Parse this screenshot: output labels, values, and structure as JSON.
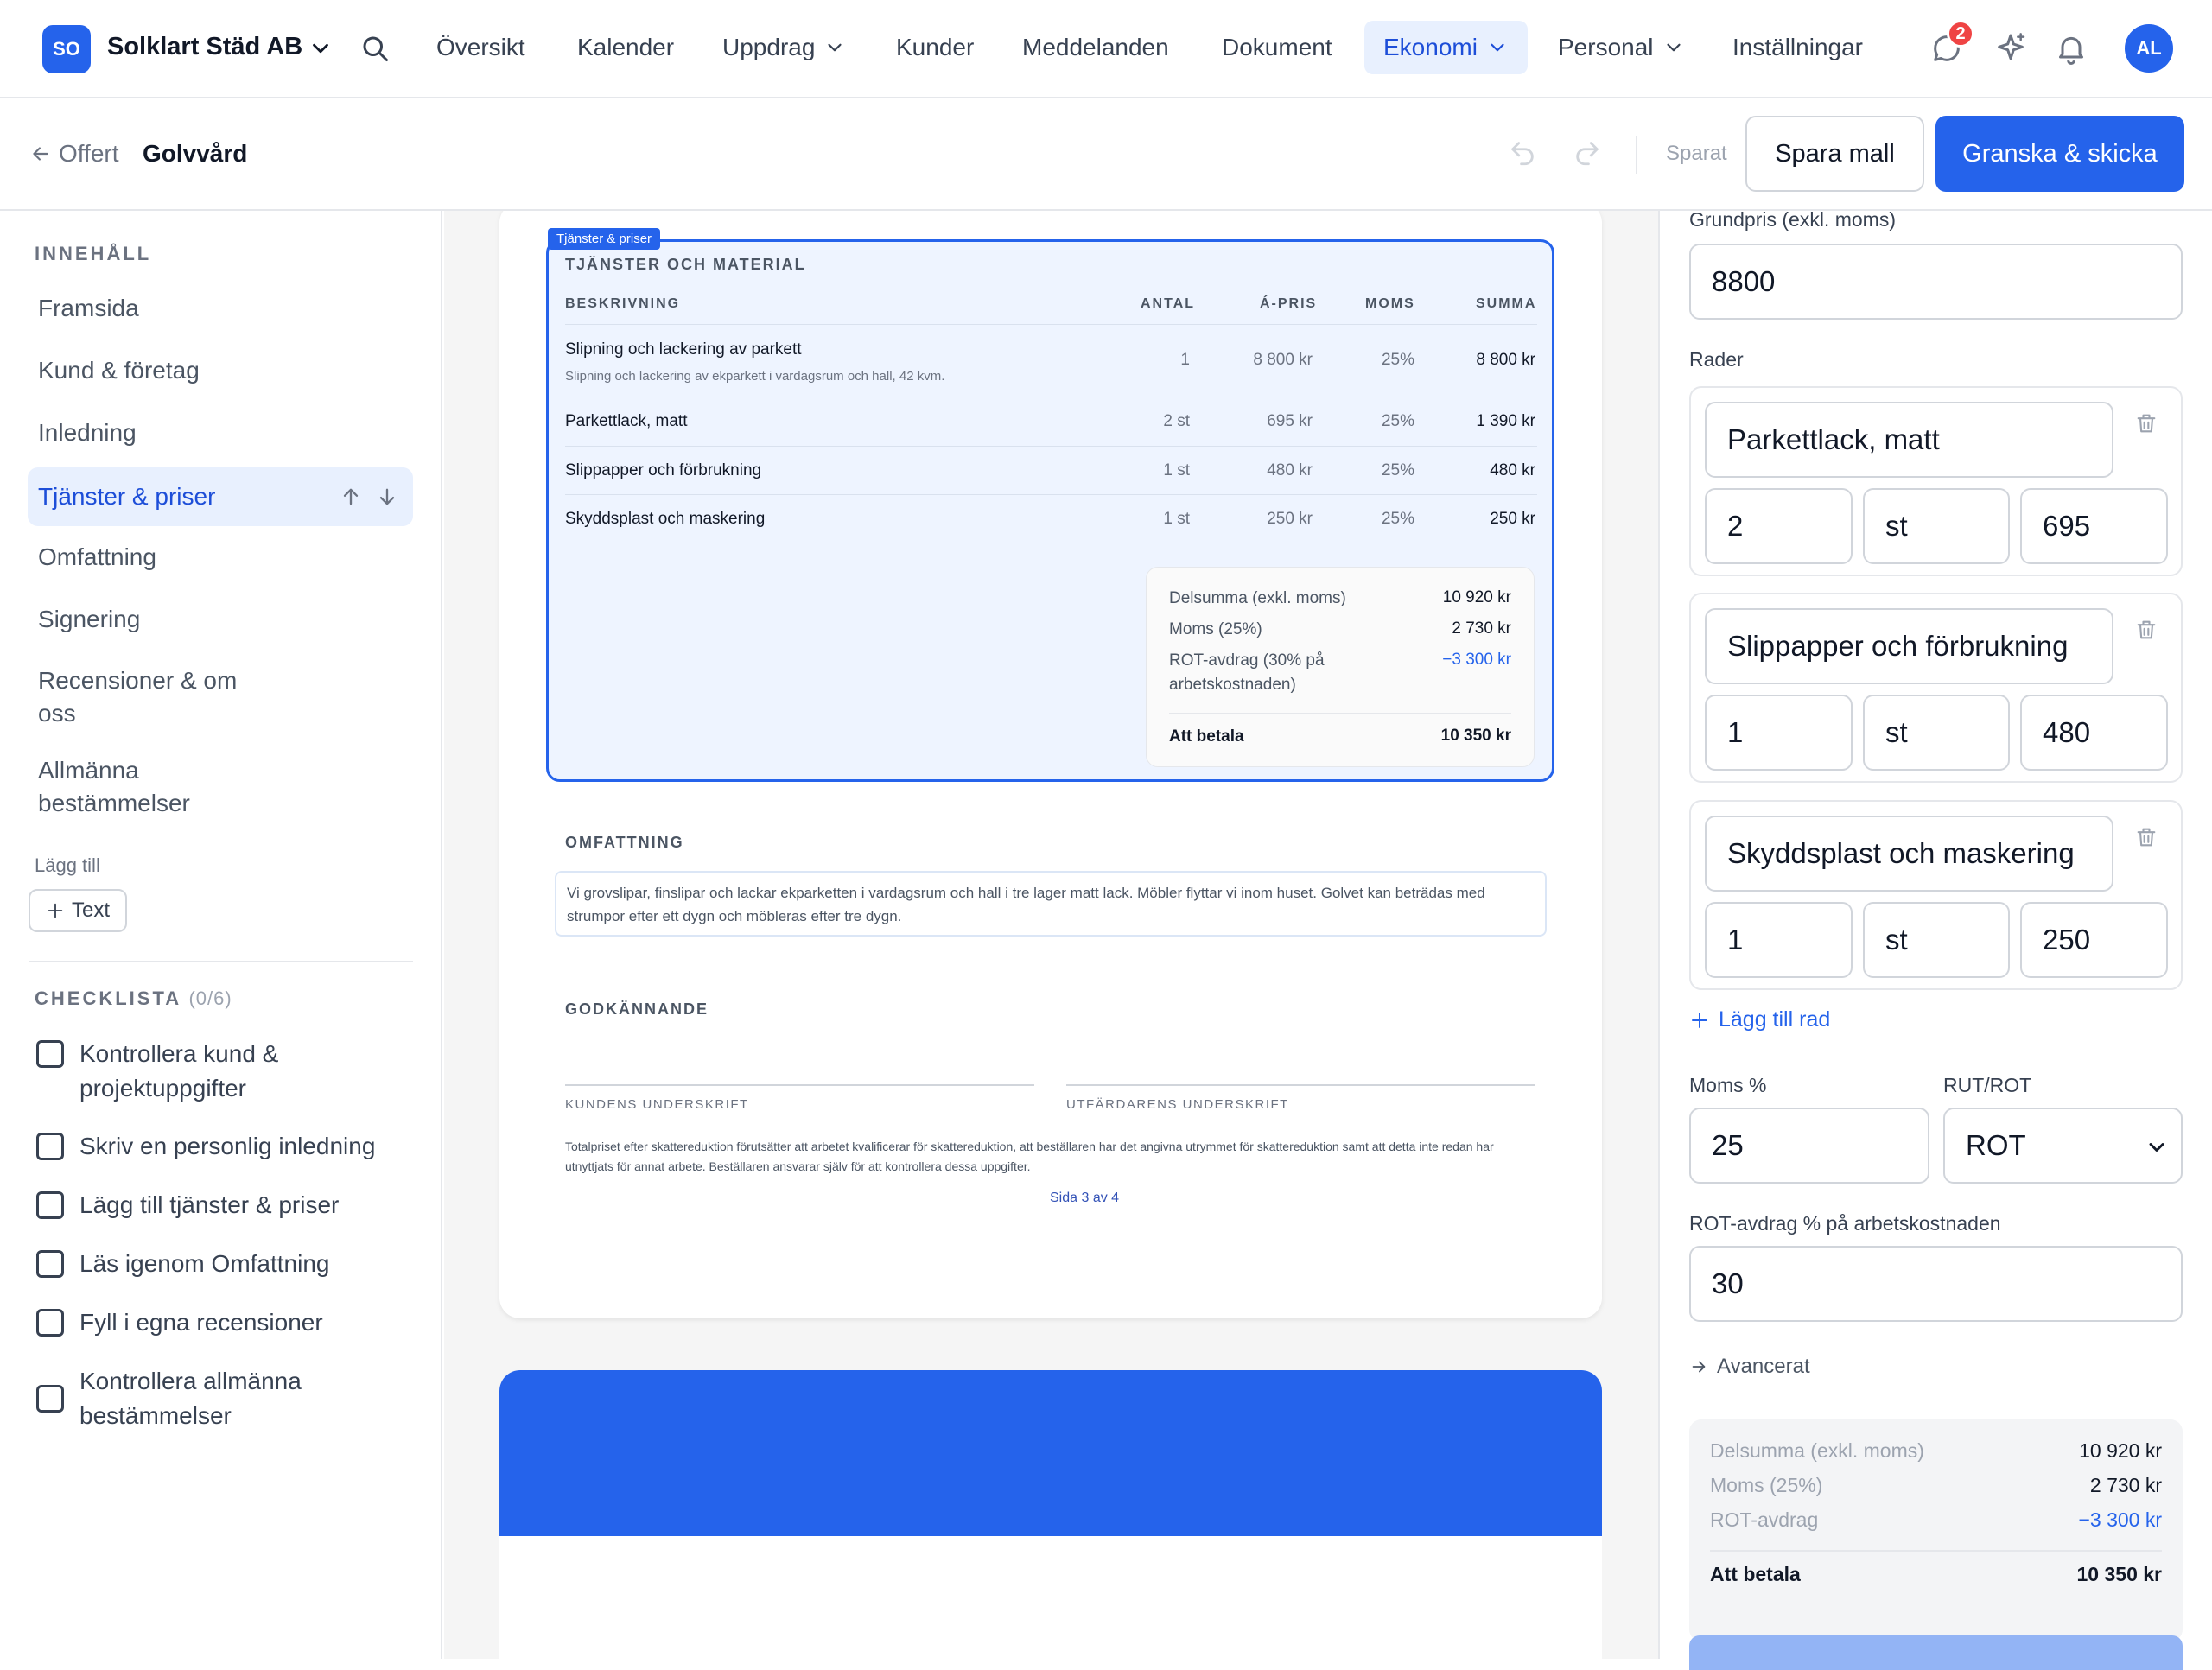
{
  "topnav": {
    "logo_text": "SO",
    "company": "Solklart Städ AB",
    "items": [
      "Översikt",
      "Kalender",
      "Uppdrag",
      "Kunder",
      "Meddelanden",
      "Dokument",
      "Ekonomi",
      "Personal",
      "Inställningar"
    ],
    "active_item": "Ekonomi",
    "notification_count": "2",
    "avatar_initials": "AL"
  },
  "subbar": {
    "breadcrumb_parent": "Offert",
    "breadcrumb_current": "Golvvård",
    "saved_status": "Sparat",
    "save_template_label": "Spara mall",
    "review_send_label": "Granska & skicka"
  },
  "sidebar": {
    "content_heading": "INNEHÅLL",
    "items": [
      "Framsida",
      "Kund & företag",
      "Inledning",
      "Tjänster & priser",
      "Omfattning",
      "Signering",
      "Recensioner & om oss",
      "Allmänna bestämmelser"
    ],
    "active_item": "Tjänster & priser",
    "add_label": "Lägg till",
    "add_text_button": "Text",
    "checklist_heading": "CHECKLISTA",
    "checklist_progress": "(0/6)",
    "checklist": [
      "Kontrollera kund & projektuppgifter",
      "Skriv en personlig inledning",
      "Lägg till tjänster & priser",
      "Läs igenom Omfattning",
      "Fyll i egna recensioner",
      "Kontrollera allmänna bestämmelser"
    ]
  },
  "document": {
    "selected_tag": "Tjänster & priser",
    "services_heading": "TJÄNSTER OCH MATERIAL",
    "columns": [
      "BESKRIVNING",
      "ANTAL",
      "Á-PRIS",
      "MOMS",
      "SUMMA"
    ],
    "rows": [
      {
        "desc": "Slipning och lackering av parkett",
        "sub": "Slipning och lackering av ekparkett i vardagsrum och hall, 42 kvm.",
        "qty": "1",
        "unit_price": "8 800 kr",
        "vat": "25%",
        "sum": "8 800 kr"
      },
      {
        "desc": "Parkettlack, matt",
        "sub": "",
        "qty": "2 st",
        "unit_price": "695 kr",
        "vat": "25%",
        "sum": "1 390 kr"
      },
      {
        "desc": "Slippapper och förbrukning",
        "sub": "",
        "qty": "1 st",
        "unit_price": "480 kr",
        "vat": "25%",
        "sum": "480 kr"
      },
      {
        "desc": "Skyddsplast och maskering",
        "sub": "",
        "qty": "1 st",
        "unit_price": "250 kr",
        "vat": "25%",
        "sum": "250 kr"
      }
    ],
    "totals": {
      "subtotal_label": "Delsumma (exkl. moms)",
      "subtotal": "10 920 kr",
      "vat_label": "Moms (25%)",
      "vat": "2 730 kr",
      "rot_label_1": "ROT-avdrag (30% på",
      "rot_label_2": "arbetskostnaden)",
      "rot": "−3 300 kr",
      "pay_label": "Att betala",
      "pay": "10 350 kr"
    },
    "scope_heading": "OMFATTNING",
    "scope_text": "Vi grovslipar, finslipar och lackar ekparketten i vardagsrum och hall i tre lager matt lack. Möbler flyttar vi inom huset. Golvet kan beträdas med strumpor efter ett dygn och möbleras efter tre dygn.",
    "approval_heading": "GODKÄNNANDE",
    "customer_signature": "KUNDENS UNDERSKRIFT",
    "issuer_signature": "UTFÄRDARENS UNDERSKRIFT",
    "disclaimer": "Totalpriset efter skattereduktion förutsätter att arbetet kvalificerar för skattereduktion, att beställaren har det angivna utrymmet för skattereduktion samt att detta inte redan har utnyttjats för annat arbete. Beställaren ansvarar själv för att kontrollera dessa uppgifter.",
    "page2_number": "Sida 3 av 4"
  },
  "panel": {
    "base_price_label": "Grundpris (exkl. moms)",
    "base_price": "8800",
    "rows_label": "Rader",
    "rows": [
      {
        "name": "Parkettlack, matt",
        "qty": "2",
        "unit": "st",
        "price": "695"
      },
      {
        "name": "Slippapper och förbrukning",
        "qty": "1",
        "unit": "st",
        "price": "480"
      },
      {
        "name": "Skyddsplast och maskering",
        "qty": "1",
        "unit": "st",
        "price": "250"
      }
    ],
    "add_row_label": "Lägg till rad",
    "vat_label": "Moms %",
    "vat_value": "25",
    "rutrot_label": "RUT/ROT",
    "rutrot_value": "ROT",
    "rot_pct_label": "ROT-avdrag % på arbetskostnaden",
    "rot_pct_value": "30",
    "advanced_label": "Avancerat",
    "summary": {
      "subtotal_label": "Delsumma (exkl. moms)",
      "subtotal": "10 920 kr",
      "vat_label": "Moms (25%)",
      "vat": "2 730 kr",
      "rot_label": "ROT-avdrag",
      "rot": "−3 300 kr",
      "pay_label": "Att betala",
      "pay": "10 350 kr"
    }
  },
  "colors": {
    "accent": "#2563eb",
    "accent_light": "#e8f0fe",
    "badge": "#ef4444"
  }
}
